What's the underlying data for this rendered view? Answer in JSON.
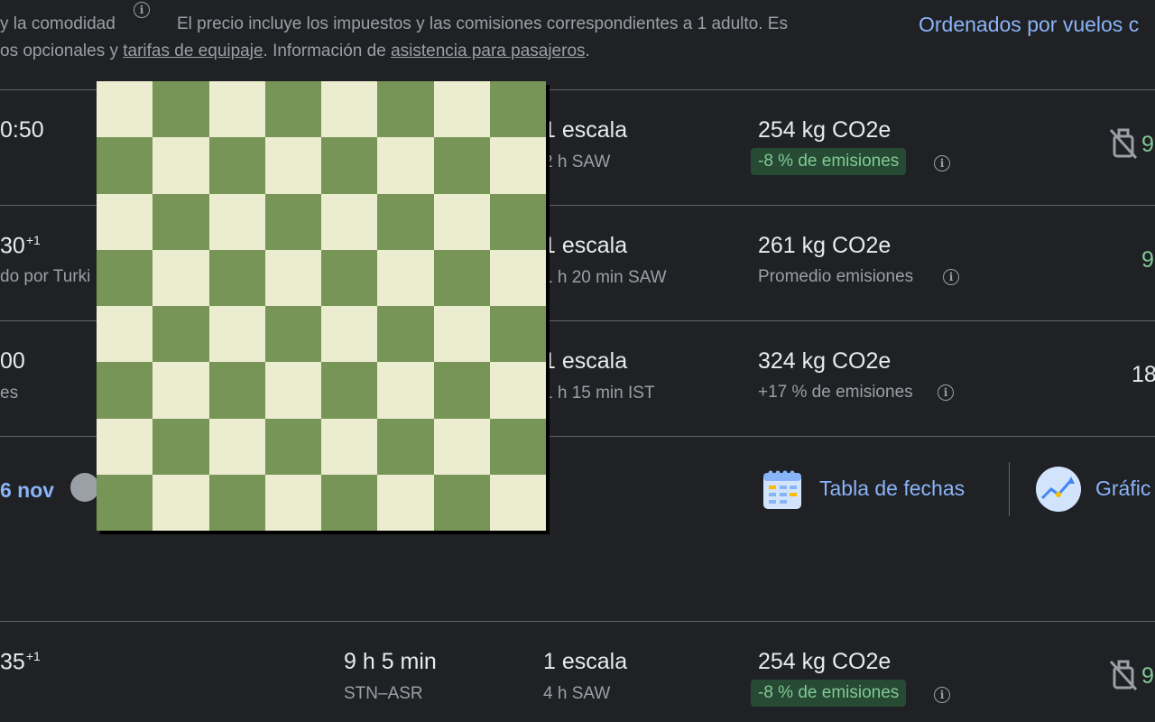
{
  "header": {
    "comfort_text": "y la comodidad",
    "price_info": "El precio incluye los impuestos y las comisiones correspondientes a 1 adulto. Es",
    "line2_prefix": "os opcionales y ",
    "baggage_link": "tarifas de equipaje",
    "line2_mid": ". Información de ",
    "assistance_link": "asistencia para pasajeros",
    "line2_end": ".",
    "sort_label": "Ordenados por vuelos c"
  },
  "flights": [
    {
      "time": "0:50",
      "time_sup": "",
      "time_sub": "",
      "stops": "1 escala",
      "stop_detail": "2 h SAW",
      "emissions": "254 kg CO2e",
      "emissions_note": "-8 % de emisiones",
      "price": "9"
    },
    {
      "time": "30",
      "time_sup": "+1",
      "time_sub": "do por Turki",
      "stops": "1 escala",
      "stop_detail": "1 h 20 min SAW",
      "emissions": "261 kg CO2e",
      "emissions_note": "Promedio emisiones",
      "price": "9"
    },
    {
      "time": "00",
      "time_sup": "",
      "time_sub": "es",
      "stops": "1 escala",
      "stop_detail": "1 h 15 min IST",
      "emissions": "324 kg CO2e",
      "emissions_note": "+17 % de emisiones",
      "price": "18"
    },
    {
      "time": "35",
      "time_sup": "+1",
      "duration": "9 h 5 min",
      "route": "STN–ASR",
      "stops": "1 escala",
      "stop_detail": "4 h SAW",
      "emissions": "254 kg CO2e",
      "emissions_note": "-8 % de emisiones",
      "price": "9"
    }
  ],
  "date_row": {
    "date_label": "6 nov",
    "date_table": "Tabla de fechas",
    "price_graph": "Gráfic"
  },
  "icons": {
    "info": "info-icon",
    "no_bag": "no-carry-on-bag-icon",
    "calendar": "calendar-icon",
    "graph": "price-graph-icon"
  },
  "colors": {
    "background": "#202124",
    "accent_blue": "#8ab4f8",
    "green": "#81c995",
    "badge_green": "#264a33",
    "chess_light": "#ebecd0",
    "chess_dark": "#779556"
  }
}
